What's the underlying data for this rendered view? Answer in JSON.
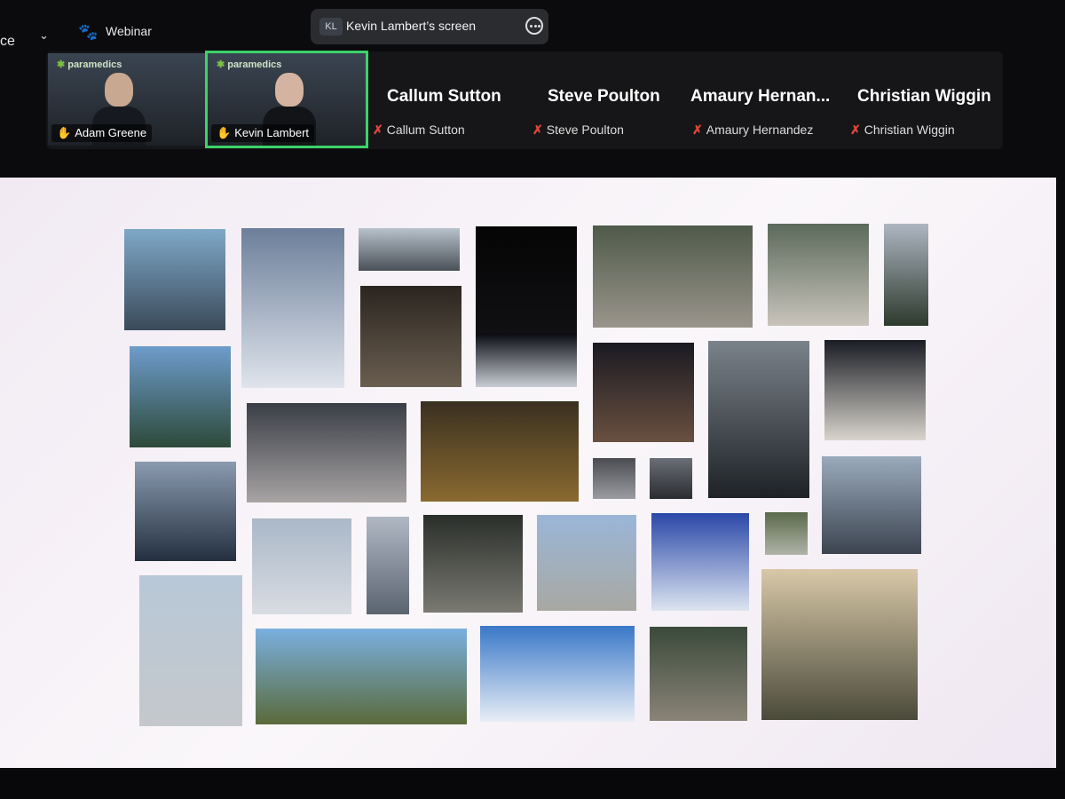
{
  "top": {
    "left_fragment": "ce",
    "webinar_label": "Webinar",
    "share_badge": "KL",
    "share_title": "Kevin Lambert’s screen"
  },
  "participants": [
    {
      "name": "Adam Greene",
      "video": true,
      "logo": "paramedics",
      "active": false
    },
    {
      "name": "Kevin Lambert",
      "video": true,
      "logo": "paramedics",
      "active": true
    },
    {
      "name": "Callum Sutton",
      "display": "Callum Sutton",
      "muted": true
    },
    {
      "name": "Steve Poulton",
      "display": "Steve Poulton",
      "muted": true
    },
    {
      "name": "Amaury Hernandez",
      "display": "Amaury  Hernan...",
      "muted": true
    },
    {
      "name": "Christian Wiggin",
      "display": "Christian Wiggin",
      "muted": true
    }
  ],
  "colors": {
    "active_speaker": "#3bd36a",
    "mic_muted": "#e0473b",
    "logo_green": "#7bc043"
  },
  "shared_screen": {
    "photos": [
      {
        "name": "helicopter-dock",
        "c1": "#7fa8c8",
        "c2": "#3a4a5a"
      },
      {
        "name": "helicopter-snow-forest",
        "c1": "#6c7f9a",
        "c2": "#dfe4ec"
      },
      {
        "name": "plane-wing-window",
        "c1": "#b8c2cc",
        "c2": "#4a5058"
      },
      {
        "name": "dark-night",
        "c1": "#050505",
        "c2": "#15151a"
      },
      {
        "name": "crashed-vehicles",
        "c1": "#4f5a4a",
        "c2": "#9a958c"
      },
      {
        "name": "rocky-river",
        "c1": "#5a6a5a",
        "c2": "#c9c4bb"
      },
      {
        "name": "road-trees",
        "c1": "#aeb6c2",
        "c2": "#2d3a2d"
      },
      {
        "name": "dim-wing-light",
        "c1": "#2b2520",
        "c2": "#6a5e50"
      },
      {
        "name": "plane-snow-night",
        "c1": "#0a0c12",
        "c2": "#c8ccd4"
      },
      {
        "name": "aerial-coast",
        "c1": "#6e9ccc",
        "c2": "#2d4a3a"
      },
      {
        "name": "dusk-plane-runway",
        "c1": "#1a1a22",
        "c2": "#6a5040"
      },
      {
        "name": "equipment-interior",
        "c1": "#7a828a",
        "c2": "#1e2226"
      },
      {
        "name": "ambulance-plane-night",
        "c1": "#1a1c24",
        "c2": "#d8d4cc"
      },
      {
        "name": "wing-storm-clouds",
        "c1": "#3a3e46",
        "c2": "#a8a4a4"
      },
      {
        "name": "cockpit-night",
        "c1": "#3a3020",
        "c2": "#8a6a30"
      },
      {
        "name": "cabin-small-1",
        "c1": "#4a4c52",
        "c2": "#9a9ca2"
      },
      {
        "name": "cabin-small-2",
        "c1": "#6a6e76",
        "c2": "#2a2c30"
      },
      {
        "name": "clouds-wing-mountains",
        "c1": "#9aaabb",
        "c2": "#3c4450"
      },
      {
        "name": "window-frost",
        "c1": "#8a9ab0",
        "c2": "#243040"
      },
      {
        "name": "helicopter-mountain",
        "c1": "#aab8c8",
        "c2": "#d8dce2"
      },
      {
        "name": "misty-inlet",
        "c1": "#b0b8c4",
        "c2": "#5a6470"
      },
      {
        "name": "aircraft-interior",
        "c1": "#2a2e2a",
        "c2": "#7a7a72"
      },
      {
        "name": "yukon-air-hangar",
        "c1": "#9ab6d8",
        "c2": "#a8a8a2"
      },
      {
        "name": "helicopter-snowfield",
        "c1": "#2a48a8",
        "c2": "#dce4f0"
      },
      {
        "name": "small-green",
        "c1": "#5a6a4a",
        "c2": "#b0b4a8"
      },
      {
        "name": "helicopter-city",
        "c1": "#b8c8d8",
        "c2": "#c4c8cc"
      },
      {
        "name": "helicopters-field",
        "c1": "#7ab0e0",
        "c2": "#5a6a3a"
      },
      {
        "name": "clouds-from-above",
        "c1": "#3a78c8",
        "c2": "#e8eef6"
      },
      {
        "name": "helicopter-beach",
        "c1": "#3a4a3a",
        "c2": "#8a8478"
      },
      {
        "name": "crew-sunset-plane",
        "c1": "#d8c8a8",
        "c2": "#4a4a3a"
      }
    ]
  }
}
